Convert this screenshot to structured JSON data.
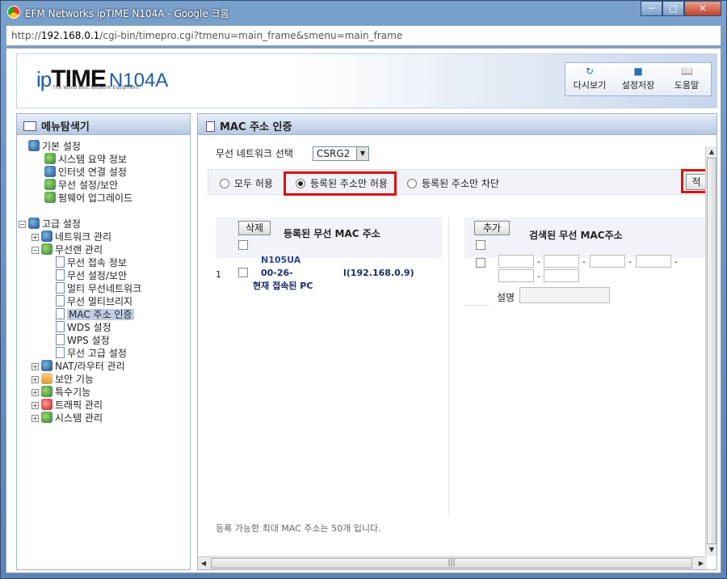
{
  "window": {
    "title": "EFM Networks ipTIME N104A - Google 크롬",
    "minimize": "─",
    "maximize": "□",
    "close": "✕"
  },
  "address": {
    "prefix": "http://",
    "host": "192.168.0.1",
    "path": "/cgi-bin/timepro.cgi?tmenu=main_frame&smenu=main_frame"
  },
  "header": {
    "logo_ip": "ip",
    "logo_time": "TIME",
    "logo_model": "N104A",
    "logo_tagline": "The World Best Network Equipment",
    "toolbar": [
      {
        "icon": "refresh-icon",
        "glyph": "↻",
        "label": "다시보기"
      },
      {
        "icon": "save-icon",
        "glyph": "■",
        "label": "설정저장"
      },
      {
        "icon": "book-icon",
        "glyph": "📖",
        "label": "도움말"
      }
    ]
  },
  "sidebar": {
    "title": "메뉴탐색기",
    "basic": {
      "label": "기본 설정",
      "items": [
        "시스템 요약 정보",
        "인터넷 연결 설정",
        "무선 설정/보안",
        "펌웨어 업그레이드"
      ]
    },
    "advanced": {
      "label": "고급 설정",
      "network": "네트워크 관리",
      "wireless": "무선랜 관리",
      "wireless_items": [
        "무선 접속 정보",
        "무선 설정/보안",
        "멀티 무선네트워크",
        "무선 멀티브리지",
        "MAC 주소 인증",
        "WDS 설정",
        "WPS 설정",
        "무선 고급 설정"
      ],
      "others": [
        "NAT/라우터 관리",
        "보안 기능",
        "특수기능",
        "트래픽 관리",
        "시스템 관리"
      ]
    }
  },
  "main": {
    "title": "MAC 주소 인증",
    "network_label": "무선 네트워크 선택",
    "network_value": "CSRG2",
    "radios": [
      "모두 허용",
      "등록된 주소만 허용",
      "등록된 주소만 차단"
    ],
    "selected_radio": 1,
    "apply_label": "적",
    "registered": {
      "delete_label": "삭제",
      "title": "등록된 무선 MAC 주소",
      "entries": [
        {
          "index": "1",
          "name": "N105UA",
          "mac": "00-26-",
          "ip": "l(192.168.0.9)",
          "note": "현재 접속된 PC"
        }
      ]
    },
    "searched": {
      "add_label": "추가",
      "title": "검색된 무선 MAC주소",
      "desc_label": "설명"
    },
    "footer_note": "등록 가능한 최대 MAC 주소는 50개 입니다."
  },
  "colors": {
    "highlight": "#dd1111",
    "link_blue": "#1d5ba7"
  }
}
